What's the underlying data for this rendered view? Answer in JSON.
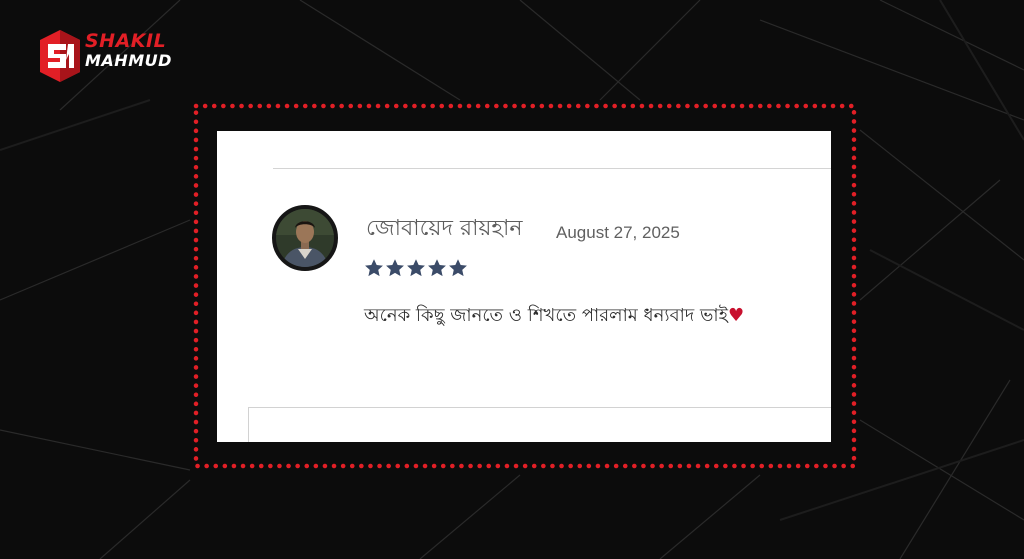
{
  "brand": {
    "line1": "SHAKIL",
    "line2": "MAHMUD",
    "accent_color": "#e21f26",
    "mark_icon": "sm-monogram-icon"
  },
  "review": {
    "reviewer_name": "জোবায়েদ রায়হান",
    "date": "August 27, 2025",
    "rating": 5,
    "rating_max": 5,
    "star_color": "#3b4b68",
    "text": "অনেক কিছু জানতে ও শিখতে পারলাম ধন্যবাদ ভাই",
    "heart_glyph": "♥",
    "avatar_icon": "reviewer-avatar-icon"
  },
  "highlight": {
    "border_style": "dotted",
    "color": "#e21f26"
  }
}
